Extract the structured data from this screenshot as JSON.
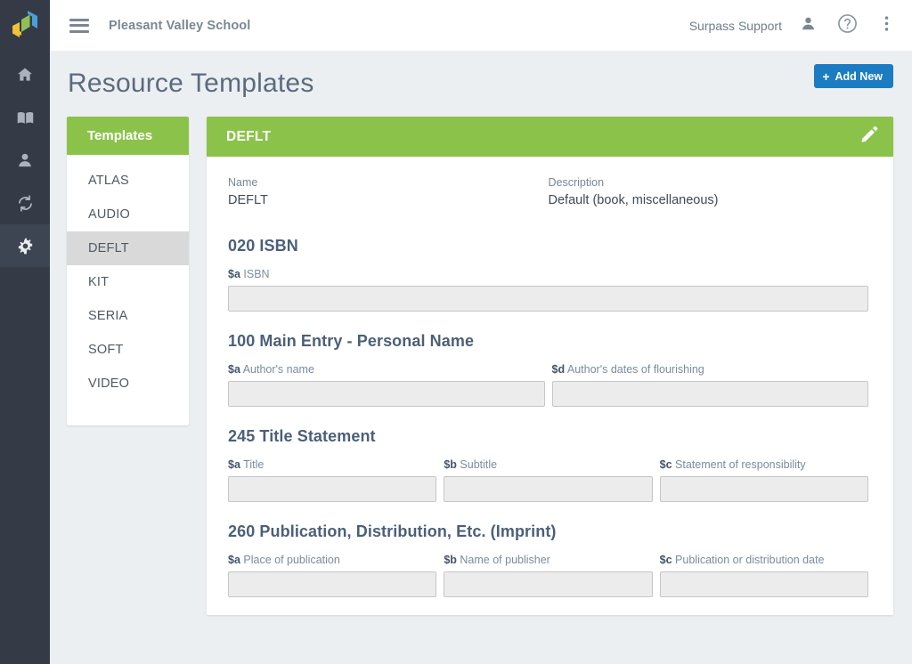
{
  "rail": {
    "logo_name": "surpass-logo",
    "items": [
      {
        "icon": "home-icon",
        "name": "home",
        "active": false
      },
      {
        "icon": "book-icon",
        "name": "catalog",
        "active": false
      },
      {
        "icon": "person-icon",
        "name": "patrons",
        "active": false
      },
      {
        "icon": "sync-icon",
        "name": "circulation",
        "active": false
      },
      {
        "icon": "gear-icon",
        "name": "settings",
        "active": true
      }
    ]
  },
  "topbar": {
    "menu_icon": "hamburger-icon",
    "school_name": "Pleasant Valley School",
    "user_label": "Surpass Support",
    "user_icon": "person-icon",
    "help_icon": "help-circle-icon",
    "overflow_icon": "more-vertical-icon"
  },
  "page": {
    "title": "Resource Templates",
    "add_new_label": "Add New",
    "add_new_icon": "plus-icon",
    "accent_blue": "#1b7cc2",
    "accent_green": "#8bc34a"
  },
  "templates_panel": {
    "header": "Templates",
    "items": [
      {
        "label": "ATLAS",
        "selected": false
      },
      {
        "label": "AUDIO",
        "selected": false
      },
      {
        "label": "DEFLT",
        "selected": true
      },
      {
        "label": "KIT",
        "selected": false
      },
      {
        "label": "SERIA",
        "selected": false
      },
      {
        "label": "SOFT",
        "selected": false
      },
      {
        "label": "VIDEO",
        "selected": false
      }
    ]
  },
  "detail": {
    "header_title": "DEFLT",
    "edit_icon": "pencil-icon",
    "meta": {
      "name_label": "Name",
      "name_value": "DEFLT",
      "description_label": "Description",
      "description_value": "Default (book, miscellaneous)"
    },
    "groups": [
      {
        "title": "020 ISBN",
        "full_width": true,
        "subfields": [
          {
            "code": "$a",
            "name": "ISBN",
            "value": ""
          }
        ]
      },
      {
        "title": "100 Main Entry - Personal Name",
        "full_width": false,
        "subfields": [
          {
            "code": "$a",
            "name": "Author's name",
            "value": ""
          },
          {
            "code": "$d",
            "name": "Author's dates of flourishing",
            "value": ""
          }
        ]
      },
      {
        "title": "245 Title Statement",
        "full_width": false,
        "subfields": [
          {
            "code": "$a",
            "name": "Title",
            "value": ""
          },
          {
            "code": "$b",
            "name": "Subtitle",
            "value": ""
          },
          {
            "code": "$c",
            "name": "Statement of responsibility",
            "value": ""
          }
        ]
      },
      {
        "title": "260 Publication, Distribution, Etc. (Imprint)",
        "full_width": false,
        "subfields": [
          {
            "code": "$a",
            "name": "Place of publication",
            "value": ""
          },
          {
            "code": "$b",
            "name": "Name of publisher",
            "value": ""
          },
          {
            "code": "$c",
            "name": "Publication or distribution date",
            "value": ""
          }
        ]
      }
    ]
  }
}
